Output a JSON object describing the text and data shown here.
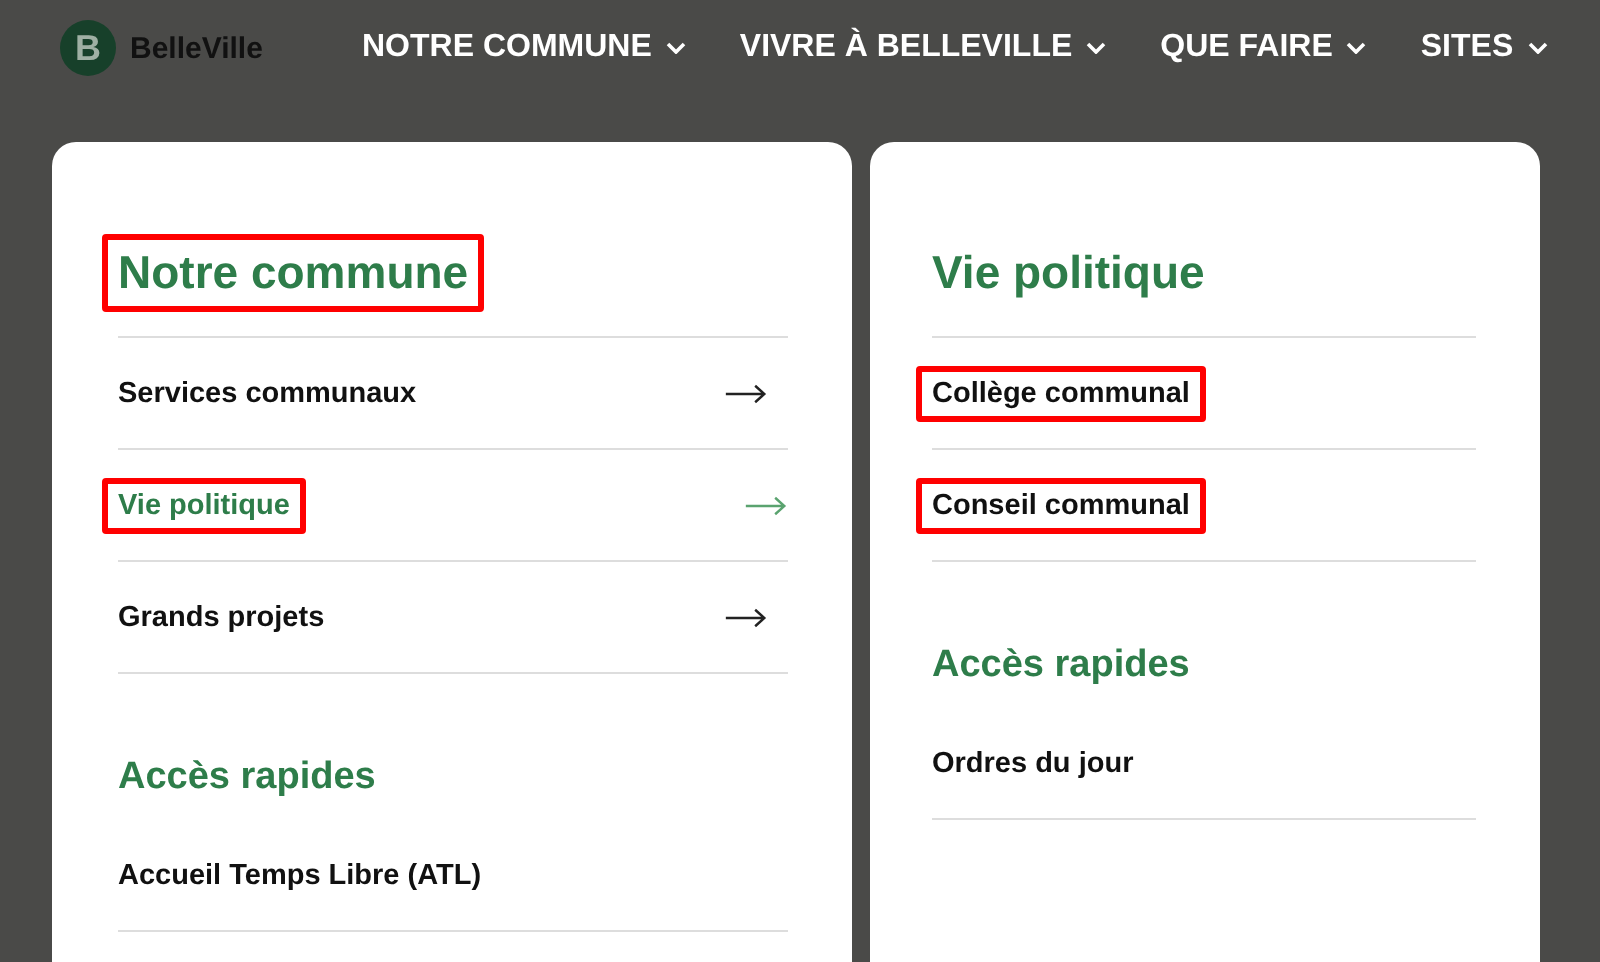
{
  "header": {
    "logo_letter": "B",
    "logo_text": "BelleVille",
    "nav": [
      {
        "label": "NOTRE COMMUNE"
      },
      {
        "label": "VIVRE À BELLEVILLE"
      },
      {
        "label": "QUE FAIRE"
      },
      {
        "label": "SITES"
      }
    ]
  },
  "panels": [
    {
      "title": "Notre commune",
      "title_highlighted": true,
      "items": [
        {
          "label": "Services communaux",
          "arrow": true,
          "selected": false,
          "highlighted": false
        },
        {
          "label": "Vie politique",
          "arrow": true,
          "selected": true,
          "highlighted": true
        },
        {
          "label": "Grands projets",
          "arrow": true,
          "selected": false,
          "highlighted": false
        }
      ],
      "section": {
        "title": "Accès rapides",
        "items": [
          {
            "label": "Accueil Temps Libre (ATL)"
          }
        ]
      }
    },
    {
      "title": "Vie politique",
      "title_highlighted": false,
      "items": [
        {
          "label": "Collège communal",
          "arrow": false,
          "selected": false,
          "highlighted": true
        },
        {
          "label": "Conseil communal",
          "arrow": false,
          "selected": false,
          "highlighted": true
        }
      ],
      "section": {
        "title": "Accès rapides",
        "items": [
          {
            "label": "Ordres du jour"
          }
        ]
      }
    }
  ]
}
